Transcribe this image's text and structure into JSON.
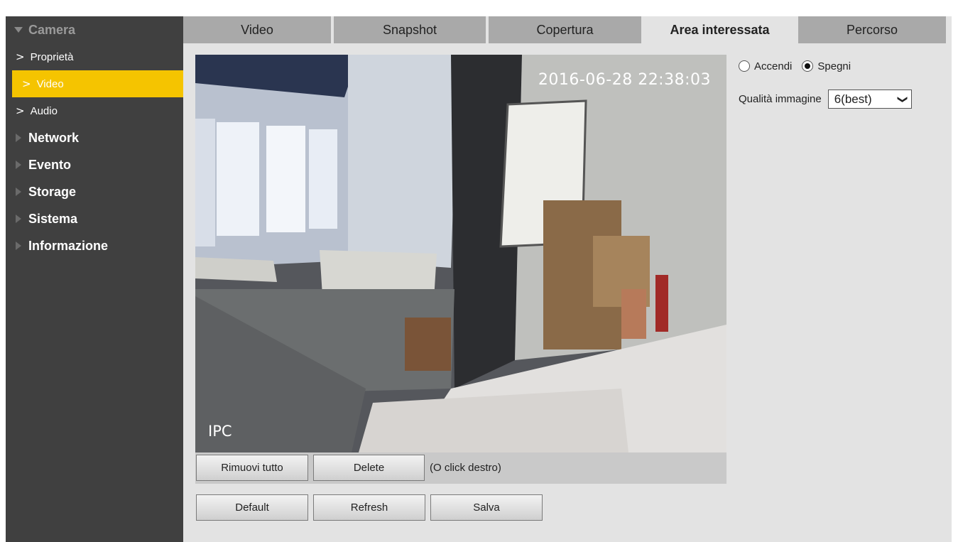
{
  "sidebar": {
    "camera": {
      "label": "Camera",
      "items": [
        "Proprietà",
        "Video",
        "Audio"
      ],
      "selected": "Video"
    },
    "groups": [
      "Network",
      "Evento",
      "Storage",
      "Sistema",
      "Informazione"
    ]
  },
  "tabs": [
    "Video",
    "Snapshot",
    "Copertura",
    "Area interessata",
    "Percorso"
  ],
  "active_tab": "Area interessata",
  "video": {
    "timestamp": "2016-06-28 22:38:03",
    "channel_label": "IPC"
  },
  "video_bar": {
    "remove_all": "Rimuovi tutto",
    "delete": "Delete",
    "hint": "(O click destro)"
  },
  "actions": {
    "default": "Default",
    "refresh": "Refresh",
    "save": "Salva"
  },
  "roi": {
    "on_label": "Accendi",
    "off_label": "Spegni",
    "selected": "Spegni",
    "quality_label": "Qualità immagine",
    "quality_value": "6(best)"
  },
  "colors": {
    "sidebar_bg": "#404040",
    "selected_item": "#f5c400",
    "tab_inactive": "#a9a9a9",
    "content_bg": "#e3e3e3"
  },
  "icons": {
    "expanded": "triangle-down-icon",
    "collapsed": "triangle-right-icon",
    "sub_item": "chevron-right-icon",
    "dropdown": "chevron-down-icon"
  }
}
